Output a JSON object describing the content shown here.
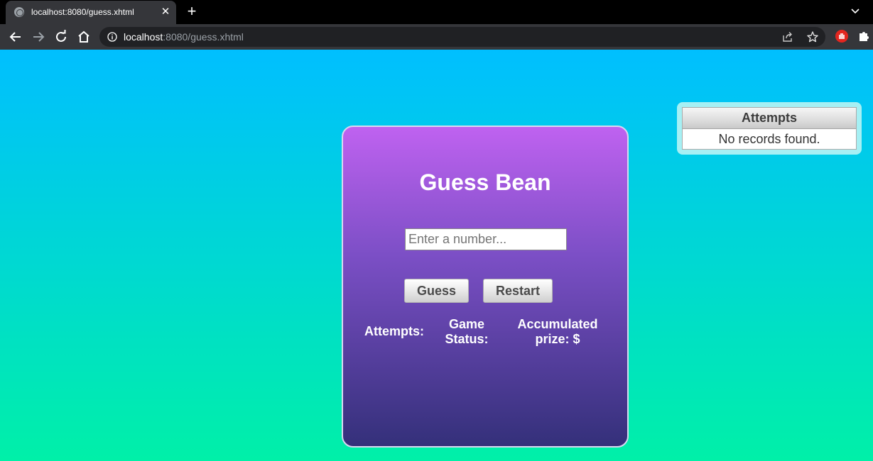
{
  "browser": {
    "tab_title": "localhost:8080/guess.xhtml",
    "tab_close": "✕",
    "new_tab": "+",
    "url_host": "localhost",
    "url_rest": ":8080/guess.xhtml"
  },
  "game": {
    "title": "Guess Bean",
    "input_placeholder": "Enter a number...",
    "guess_label": "Guess",
    "restart_label": "Restart",
    "attempts_label": "Attempts:",
    "status_label_line1": "Game",
    "status_label_line2": "Status:",
    "prize_label_line1": "Accumulated",
    "prize_label_line2": "prize: $"
  },
  "attempts_table": {
    "header": "Attempts",
    "empty_message": "No records found."
  },
  "colors": {
    "page_gradient_top": "#00bfff",
    "page_gradient_bottom": "#00f0a8",
    "card_gradient_top": "#bf62f0",
    "card_gradient_bottom": "#34307a"
  }
}
